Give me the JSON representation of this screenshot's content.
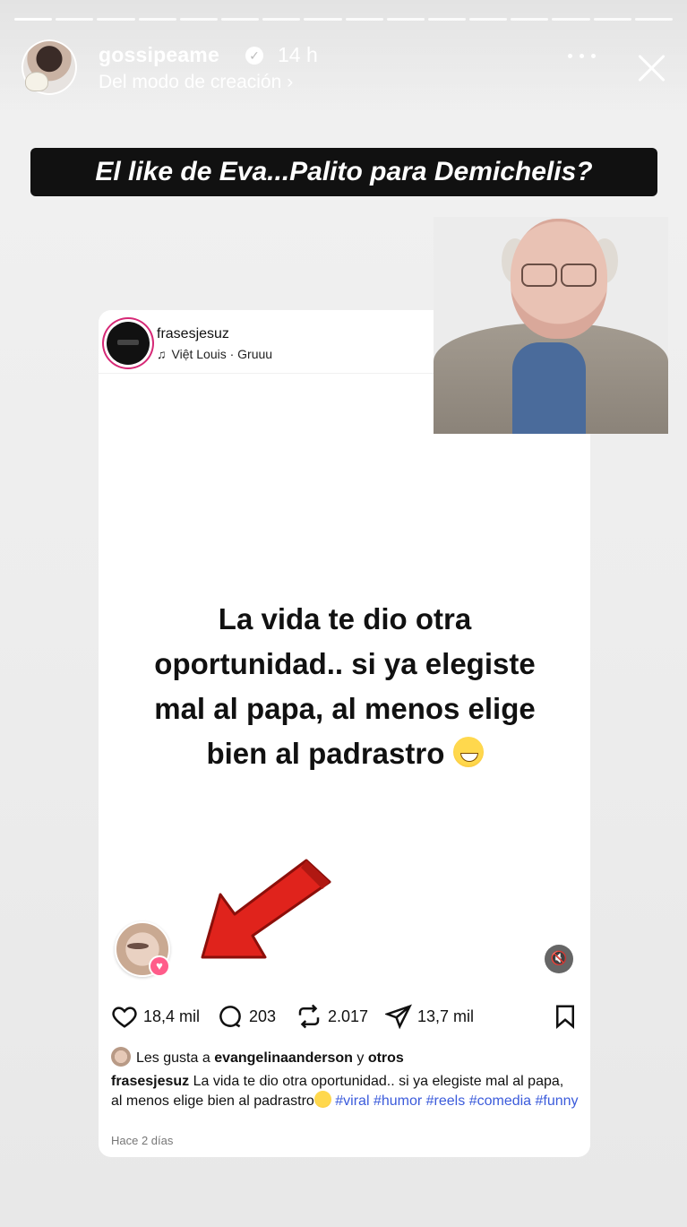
{
  "story": {
    "username": "gossipeame",
    "time": "14 h",
    "subline": "Del modo de creación",
    "headline": "El like de Eva...Palito para Demichelis?",
    "progress_segments": 16,
    "icons": {
      "verified": "verified-badge-icon",
      "more": "more-icon",
      "close": "close-icon"
    }
  },
  "post": {
    "username": "frasesjesuz",
    "music": "Việt Louis · Gruuu",
    "text_lines": [
      "La vida te dio otra",
      "oportunidad.. si ya elegiste",
      "mal al papa, al menos elige",
      "bien al padrastro"
    ],
    "stats": {
      "likes": "18,4 mil",
      "comments": "203",
      "reposts": "2.017",
      "shares": "13,7 mil"
    },
    "liked_by_prefix": "Les gusta a",
    "liked_by_user": "evangelinaanderson",
    "liked_by_mid": "y",
    "liked_by_suffix": "otros",
    "caption_user": "frasesjesuz",
    "caption_text": "La vida te dio otra oportunidad.. si ya elegiste mal al papa, al menos elige bien al padrastro",
    "hashtags": [
      "#viral",
      "#humor",
      "#reels",
      "#comedia",
      "#funny"
    ],
    "ago": "Hace 2 días"
  },
  "colors": {
    "headline_bg": "#111111",
    "hashtag": "#3b5bdb",
    "arrow": "#e0231c",
    "story_ring": "#d62976"
  }
}
